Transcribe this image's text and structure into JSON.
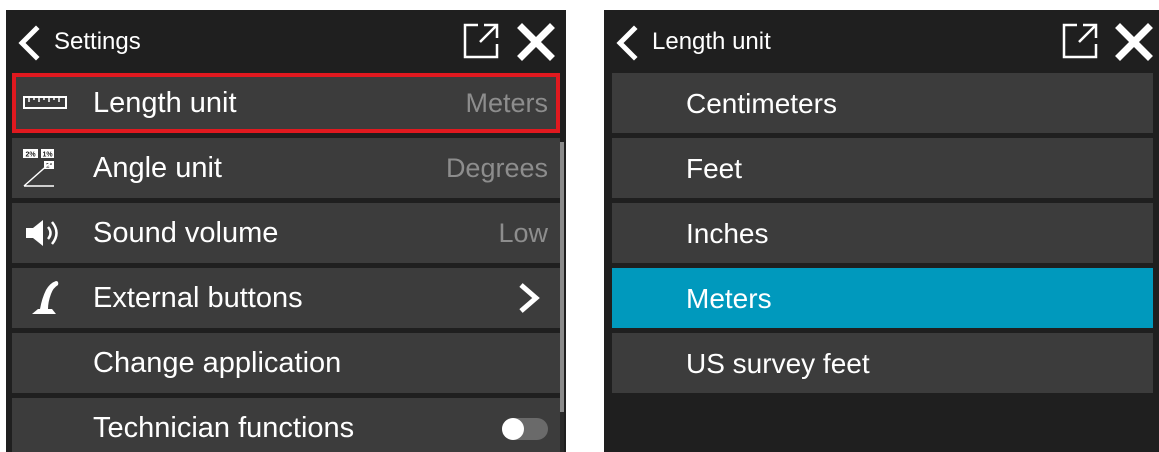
{
  "settings": {
    "title": "Settings",
    "icons": {
      "back": "chevron-left-icon",
      "popout": "open-external-icon",
      "close": "close-icon"
    },
    "items": [
      {
        "label": "Length unit",
        "value": "Meters",
        "icon": "ruler-icon",
        "highlighted": true
      },
      {
        "label": "Angle unit",
        "value": "Degrees",
        "icon": "angle-unit-icon",
        "icon_text": [
          "2%",
          "1%",
          "2°"
        ]
      },
      {
        "label": "Sound volume",
        "value": "Low",
        "icon": "speaker-icon"
      },
      {
        "label": "External buttons",
        "icon": "joystick-icon",
        "trailing": "chevron-right-icon"
      },
      {
        "label": "Change application"
      },
      {
        "label": "Technician functions",
        "toggle": "off"
      }
    ]
  },
  "length_unit": {
    "title": "Length unit",
    "icons": {
      "back": "chevron-left-icon",
      "popout": "open-external-icon",
      "close": "close-icon"
    },
    "options": [
      {
        "label": "Centimeters"
      },
      {
        "label": "Feet"
      },
      {
        "label": "Inches"
      },
      {
        "label": "Meters",
        "selected": true
      },
      {
        "label": "US survey feet"
      }
    ]
  },
  "colors": {
    "background": "#1f1f1f",
    "row": "#3c3c3c",
    "selected": "#0099bd",
    "highlight_border": "#e0191f",
    "value_text": "#8d8d8d"
  }
}
